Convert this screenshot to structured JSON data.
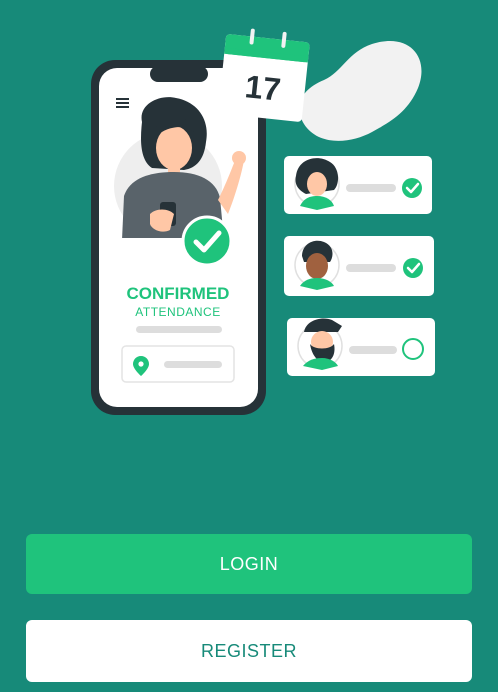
{
  "illustration": {
    "calendar_day": "17",
    "status_title": "CONFIRMED",
    "status_subtitle": "ATTENDANCE",
    "menu_icon": "hamburger-menu-icon",
    "location_icon": "location-pin-icon",
    "check_icon": "check-circle-icon",
    "attendees": [
      {
        "name": "attendee-woman",
        "confirmed": true
      },
      {
        "name": "attendee-man",
        "confirmed": true
      },
      {
        "name": "attendee-bearded-man",
        "confirmed": false
      }
    ]
  },
  "actions": {
    "login_label": "LOGIN",
    "register_label": "REGISTER"
  },
  "colors": {
    "background": "#178a79",
    "accent_green": "#1fc37c",
    "white": "#ffffff",
    "dark": "#263238"
  }
}
